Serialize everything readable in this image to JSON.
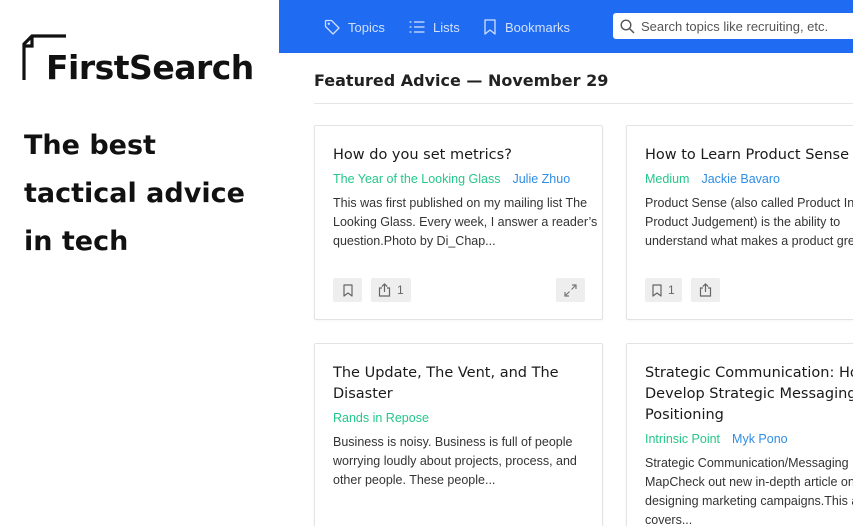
{
  "brand": {
    "name": "FirstSearch",
    "tagline": [
      "The best",
      "tactical advice",
      "in tech"
    ]
  },
  "nav": {
    "items": [
      {
        "label": "Topics",
        "icon": "tag-icon"
      },
      {
        "label": "Lists",
        "icon": "list-icon"
      },
      {
        "label": "Bookmarks",
        "icon": "bookmark-icon"
      }
    ],
    "search": {
      "placeholder": "Search topics like recruiting, etc.",
      "icon": "search-icon"
    },
    "accent": "#1f6bf2"
  },
  "main": {
    "title": "Featured Advice — November 29"
  },
  "cards": [
    {
      "title": [
        "How do you set metrics?"
      ],
      "source": "The Year of the Looking Glass",
      "author": "Julie Zhuo",
      "excerpt": [
        "This was first published on my mailing list The",
        "Looking Glass. Every week, I answer a reader’s",
        "question.Photo by Di_Chap..."
      ],
      "bookmark_count": "",
      "share_count": "1"
    },
    {
      "title": [
        "How to Learn Product Sense"
      ],
      "source": "Medium",
      "author": "Jackie Bavaro",
      "excerpt": [
        "Product Sense (also called Product Intu",
        "Product Judgement) is the ability to",
        "understand what makes a product gre..."
      ],
      "bookmark_count": "1",
      "share_count": ""
    },
    {
      "title": [
        "The Update, The Vent, and The",
        "Disaster"
      ],
      "source": "Rands in Repose",
      "author": "",
      "excerpt": [
        "Business is noisy. Business is full of people",
        "worrying loudly about projects, process, and",
        "other people. These people..."
      ]
    },
    {
      "title": [
        "Strategic Communication: How",
        "Develop Strategic Messaging &",
        "Positioning"
      ],
      "source": "Intrinsic Point",
      "author": "Myk Pono",
      "excerpt": [
        "Strategic Communication/Messaging",
        "MapCheck out new in-depth article on",
        "designing marketing campaigns.This ar",
        "covers..."
      ]
    }
  ],
  "colors": {
    "source": "#24c78a",
    "author": "#2f8de4"
  }
}
